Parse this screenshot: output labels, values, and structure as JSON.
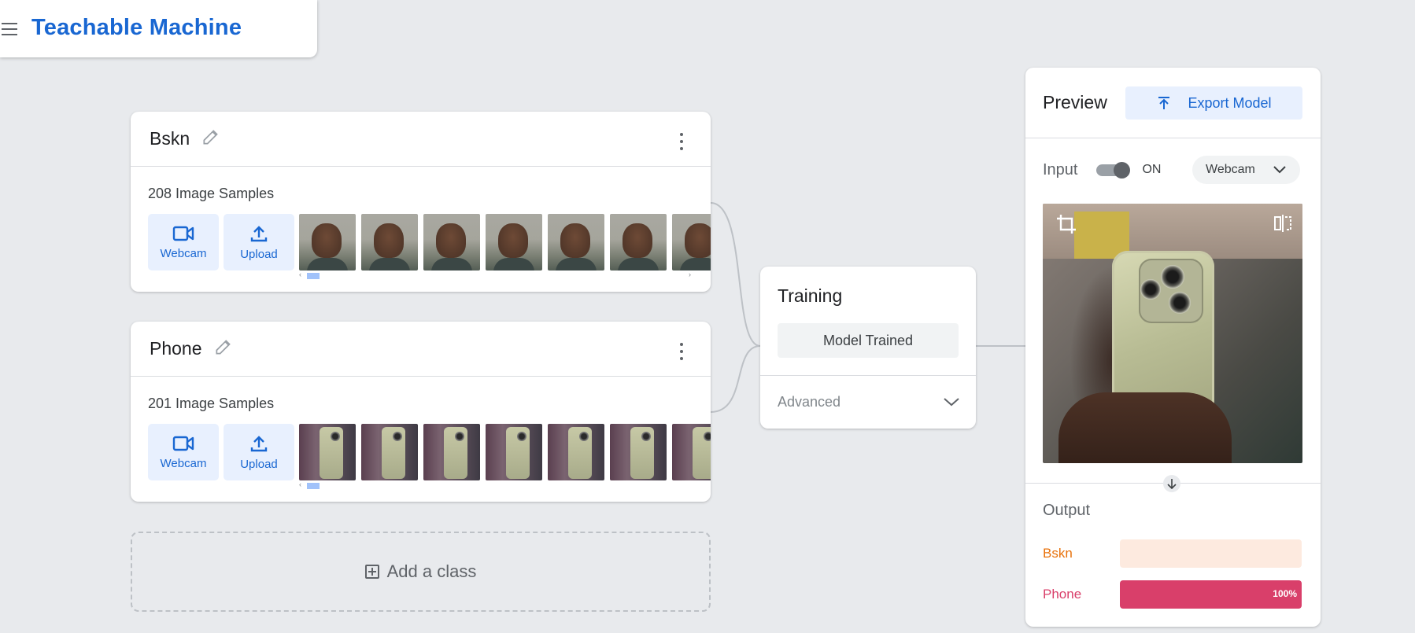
{
  "header": {
    "title": "Teachable Machine"
  },
  "classes": [
    {
      "name": "Bskn",
      "sample_count": "208 Image Samples",
      "webcam_label": "Webcam",
      "upload_label": "Upload",
      "thumb_kind": "face"
    },
    {
      "name": "Phone",
      "sample_count": "201 Image Samples",
      "webcam_label": "Webcam",
      "upload_label": "Upload",
      "thumb_kind": "phone"
    }
  ],
  "add_class": {
    "label": "Add a class"
  },
  "training": {
    "title": "Training",
    "button_label": "Model Trained",
    "advanced_label": "Advanced"
  },
  "preview": {
    "title": "Preview",
    "export_label": "Export Model",
    "input_label": "Input",
    "toggle_state": "ON",
    "source": "Webcam",
    "output_title": "Output",
    "outputs": [
      {
        "label": "Bskn",
        "value": 0,
        "pct_text": "",
        "color": "#e8710a",
        "track": "#fdeadf"
      },
      {
        "label": "Phone",
        "value": 1.0,
        "pct_text": "100%",
        "color": "#d93f6a",
        "track": "#fce4ec"
      }
    ]
  },
  "colors": {
    "accent": "#1967d2",
    "background": "#e8eaed"
  }
}
